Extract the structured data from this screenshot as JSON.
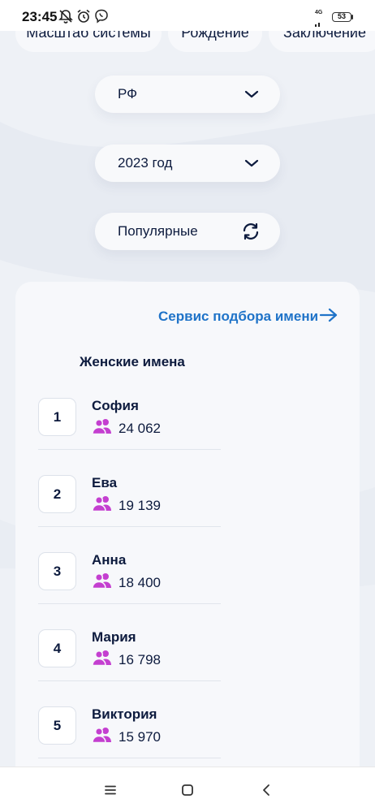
{
  "status_bar": {
    "time": "23:45",
    "network": "4G",
    "battery": "53",
    "icons": [
      "bell-off-icon",
      "alarm-icon",
      "viber-icon",
      "signal-icon",
      "battery-icon"
    ]
  },
  "tabs": [
    {
      "label": "Масштаб системы"
    },
    {
      "label": "Рождение"
    },
    {
      "label": "Заключение"
    }
  ],
  "filters": {
    "region": {
      "value": "РФ",
      "icon": "chevron-down-icon"
    },
    "year": {
      "value": "2023 год",
      "icon": "chevron-down-icon"
    },
    "sort": {
      "value": "Популярные",
      "icon": "refresh-icon"
    }
  },
  "card": {
    "service_link": "Сервис подбора имени",
    "service_icon": "arrow-right-icon",
    "section_title": "Женские имена",
    "names": [
      {
        "rank": "1",
        "name": "София",
        "count": "24 062"
      },
      {
        "rank": "2",
        "name": "Ева",
        "count": "19 139"
      },
      {
        "rank": "3",
        "name": "Анна",
        "count": "18 400"
      },
      {
        "rank": "4",
        "name": "Мария",
        "count": "16 798"
      },
      {
        "rank": "5",
        "name": "Виктория",
        "count": "15 970"
      }
    ]
  },
  "nav_bar": {
    "icons": [
      "menu-icon",
      "home-square-icon",
      "back-icon"
    ]
  },
  "colors": {
    "accent": "#1f73c8",
    "text": "#0d1b3e",
    "people_icon": "#c43fd0",
    "background": "#eef1f6"
  }
}
